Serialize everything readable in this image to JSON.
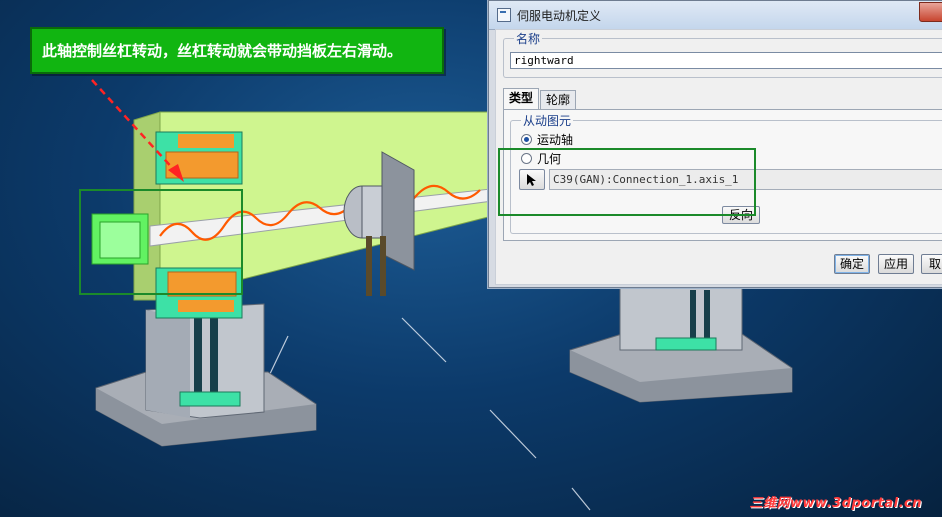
{
  "annotation": {
    "text": "此轴控制丝杠转动，丝杠转动就会带动挡板左右滑动。"
  },
  "dialog": {
    "title": "伺服电动机定义",
    "name_group_label": "名称",
    "name_value": "rightward",
    "tabs": [
      {
        "label": "类型",
        "active": true
      },
      {
        "label": "轮廓",
        "active": false
      }
    ],
    "driven_group_label": "从动图元",
    "radio_options": [
      {
        "label": "运动轴",
        "checked": true
      },
      {
        "label": "几何",
        "checked": false
      }
    ],
    "selected_reference": "C39(GAN):Connection_1.axis_1",
    "reverse_label": "反向",
    "ok_label": "确定",
    "apply_label": "应用",
    "cancel_label": "取"
  },
  "watermark": "三维网www.3dportal.cn",
  "colors": {
    "background": "#0c3a6a",
    "callout": "#11b511",
    "highlight": "#1b8a2a",
    "plate": "#cff58f",
    "block_orange": "#f39a2e",
    "block_green": "#3de1a6",
    "base": "#a9aeb6",
    "spring": "#ff5a00"
  }
}
